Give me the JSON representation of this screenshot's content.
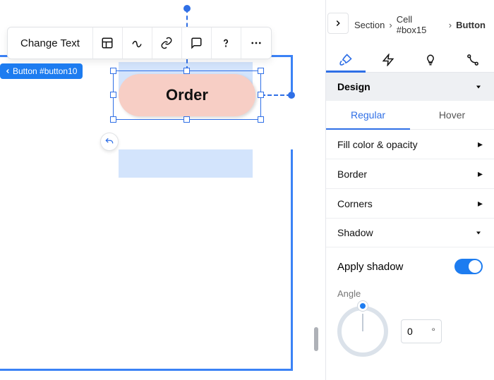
{
  "breadcrumbs": {
    "a": "Section",
    "b": "Cell #box15",
    "c": "Button"
  },
  "toolbar": {
    "change_text": "Change Text"
  },
  "tag": {
    "label": "Button #button10"
  },
  "button": {
    "label": "Order"
  },
  "section": {
    "design": "Design"
  },
  "subtabs": {
    "regular": "Regular",
    "hover": "Hover"
  },
  "props": {
    "fill": "Fill color & opacity",
    "border": "Border",
    "corners": "Corners",
    "shadow": "Shadow",
    "apply_shadow": "Apply shadow"
  },
  "angle": {
    "label": "Angle",
    "value": "0",
    "unit": "°"
  },
  "toggles": {
    "apply_shadow": true
  }
}
